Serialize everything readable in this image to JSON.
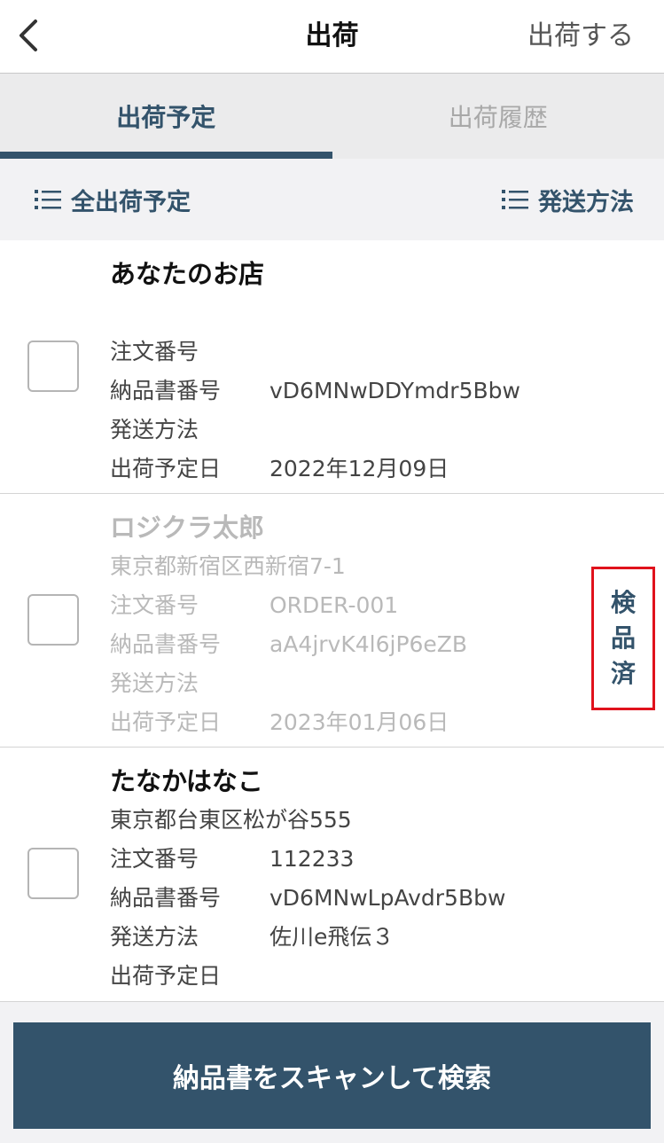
{
  "header": {
    "title": "出荷",
    "action_label": "出荷する"
  },
  "tabs": [
    {
      "label": "出荷予定",
      "active": true
    },
    {
      "label": "出荷履歴",
      "active": false
    }
  ],
  "filters": {
    "all_label": "全出荷予定",
    "method_label": "発送方法"
  },
  "labels": {
    "order_number": "注文番号",
    "invoice_number": "納品書番号",
    "shipping_method": "発送方法",
    "ship_date": "出荷予定日"
  },
  "items": [
    {
      "name": "あなたのお店",
      "address": "",
      "order_number": "",
      "invoice_number": "vD6MNwDDYmdr5Bbw",
      "shipping_method": "",
      "ship_date": "2022年12月09日",
      "inspected": false
    },
    {
      "name": "ロジクラ太郎",
      "address": "東京都新宿区西新宿7-1",
      "order_number": "ORDER-001",
      "invoice_number": "aA4jrvK4l6jP6eZB",
      "shipping_method": "",
      "ship_date": "2023年01月06日",
      "inspected": true,
      "inspected_label": [
        "検",
        "品",
        "済"
      ]
    },
    {
      "name": "たなかはなこ",
      "address": "東京都台東区松が谷555",
      "order_number": "112233",
      "invoice_number": "vD6MNwLpAvdr5Bbw",
      "shipping_method": "佐川e飛伝３",
      "ship_date": "",
      "inspected": false
    }
  ],
  "scan_button_label": "納品書をスキャンして検索",
  "colors": {
    "accent": "#33536b",
    "highlight_border": "#e0121c"
  }
}
